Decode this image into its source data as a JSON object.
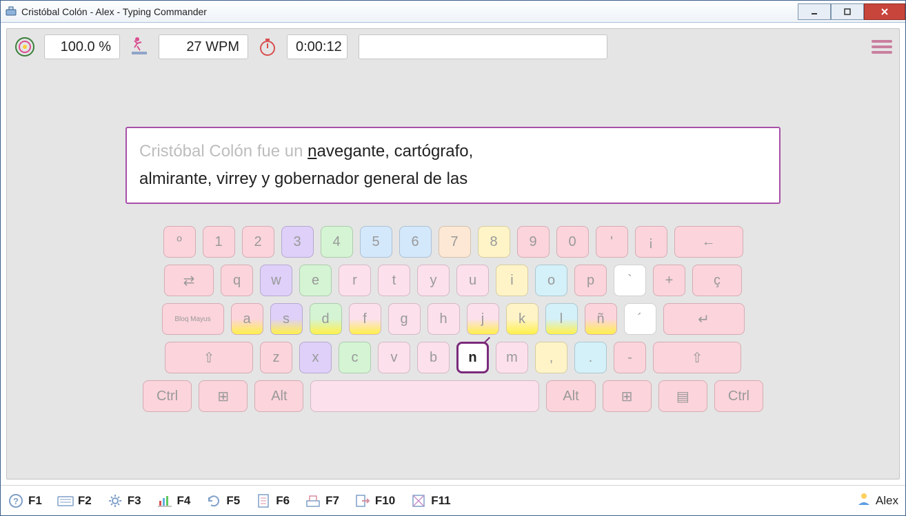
{
  "window": {
    "title": "Cristóbal Colón - Alex - Typing Commander"
  },
  "stats": {
    "accuracy": "100.0 %",
    "wpm": "27 WPM",
    "time": "0:00:12"
  },
  "text": {
    "typed": "Cristóbal Colón fue un ",
    "cursor": "n",
    "pending_line1": "avegante, cartógrafo,",
    "pending_line2": "almirante, virrey y gobernador general de las"
  },
  "highlight_key": "n",
  "keyboard": {
    "row1": [
      "º",
      "1",
      "2",
      "3",
      "4",
      "5",
      "6",
      "7",
      "8",
      "9",
      "0",
      "'",
      "¡",
      "←"
    ],
    "row2": [
      "⇄",
      "q",
      "w",
      "e",
      "r",
      "t",
      "y",
      "u",
      "i",
      "o",
      "p",
      "`",
      "+",
      "ç"
    ],
    "row3": [
      "Bloq Mayus",
      "a",
      "s",
      "d",
      "f",
      "g",
      "h",
      "j",
      "k",
      "l",
      "ñ",
      "´",
      "↵"
    ],
    "row4": [
      "⇧",
      "z",
      "x",
      "c",
      "v",
      "b",
      "n",
      "m",
      ",",
      ".",
      "-",
      "⇧"
    ],
    "row5": [
      "Ctrl",
      "⊞",
      "Alt",
      " ",
      "Alt",
      "⊞",
      "▤",
      "Ctrl"
    ]
  },
  "colors": {
    "row1": [
      "#fcd4dc",
      "#fcd4dc",
      "#fcd4dc",
      "#ded0f8",
      "#d4f4d4",
      "#d4e8fc",
      "#d4e8fc",
      "#fce8d4",
      "#fff4c8",
      "#fcd4dc",
      "#fcd4dc",
      "#fcd4dc",
      "#fcd4dc",
      "#fcd4dc"
    ],
    "row2": [
      "#fcd4dc",
      "#fcd4dc",
      "#ded0f8",
      "#d4f4d4",
      "#fce0ec",
      "#fce0ec",
      "#fce0ec",
      "#fce0ec",
      "#fff4c8",
      "#d4f0f8",
      "#fcd4dc",
      "#ffffff",
      "#fcd4dc",
      "#fcd4dc"
    ],
    "row3": [
      "#fcd4dc",
      "#fcd4dc",
      "#ded0f8",
      "#d4f4d4",
      "#fce0ec",
      "#fce0ec",
      "#fce0ec",
      "#fce0ec",
      "#fff4c8",
      "#d4f0f8",
      "#fcd4dc",
      "#ffffff",
      "#fcd4dc"
    ],
    "row4": [
      "#fcd4dc",
      "#fcd4dc",
      "#ded0f8",
      "#d4f4d4",
      "#fce0ec",
      "#fce0ec",
      "#fce0ec",
      "#fce0ec",
      "#fff4c8",
      "#d4f0f8",
      "#fcd4dc",
      "#fcd4dc"
    ],
    "row5": [
      "#fcd4dc",
      "#fcd4dc",
      "#fcd4dc",
      "#fce0ec",
      "#fcd4dc",
      "#fcd4dc",
      "#fcd4dc",
      "#fcd4dc"
    ]
  },
  "home_keys": [
    "a",
    "s",
    "d",
    "f",
    "j",
    "k",
    "l",
    "ñ"
  ],
  "footer": {
    "f1": "F1",
    "f2": "F2",
    "f3": "F3",
    "f4": "F4",
    "f5": "F5",
    "f6": "F6",
    "f7": "F7",
    "f10": "F10",
    "f11": "F11",
    "user": "Alex"
  }
}
